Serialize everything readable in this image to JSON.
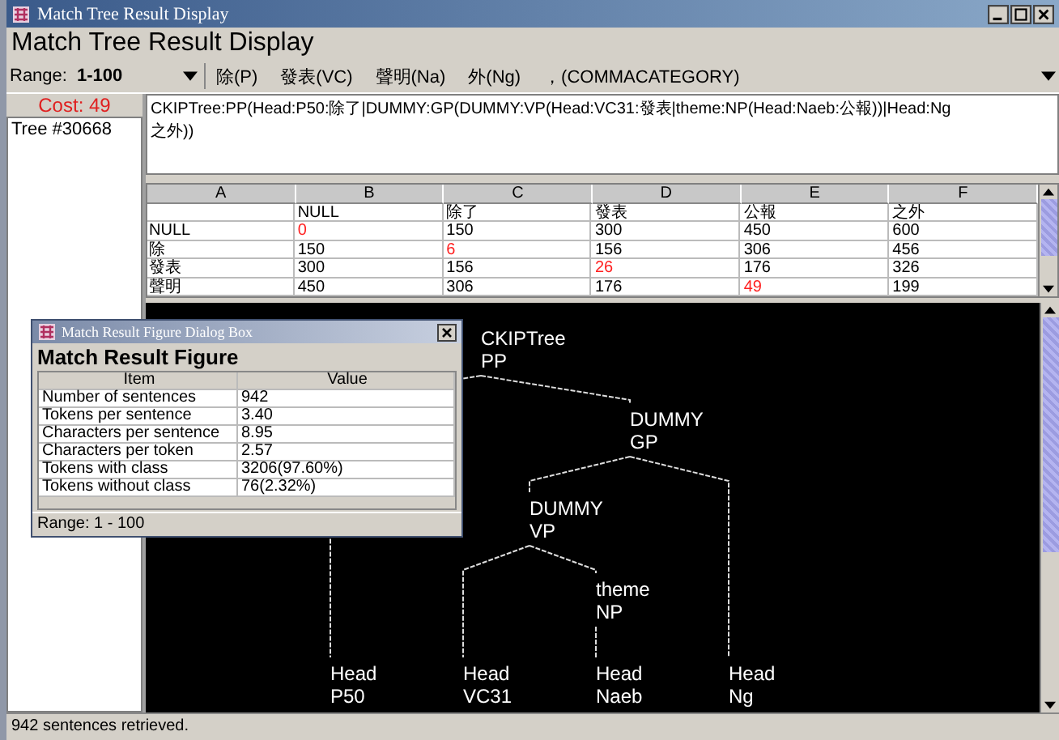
{
  "window": {
    "title": "Match Tree Result Display"
  },
  "heading": "Match Tree Result Display",
  "toolbar": {
    "range_label": "Range:",
    "range_value": "1-100",
    "tokens": [
      "除(P)",
      "發表(VC)",
      "聲明(Na)",
      "外(Ng)",
      "，(COMMACATEGORY)"
    ]
  },
  "sidebar": {
    "cost": "Cost: 49",
    "items": [
      {
        "label": "Tree #30668",
        "selected": false
      }
    ]
  },
  "bracket_text": [
    "CKIPTree:PP(Head:P50:除了|DUMMY:GP(DUMMY:VP(Head:VC31:發表|theme:NP(Head:Naeb:公報))|Head:Ng",
    "之外))"
  ],
  "table": {
    "columns": [
      "A",
      "B",
      "C",
      "D",
      "E",
      "F"
    ],
    "column_labels": [
      "NULL",
      "除了",
      "發表",
      "公報",
      "之外"
    ],
    "rows": [
      {
        "label": "NULL",
        "cells": [
          {
            "text": "0",
            "highlighted": true
          },
          {
            "text": "150",
            "highlighted": false
          },
          {
            "text": "300",
            "highlighted": false
          },
          {
            "text": "450",
            "highlighted": false
          },
          {
            "text": "600",
            "highlighted": false
          }
        ]
      },
      {
        "label": "除",
        "cells": [
          {
            "text": "150",
            "highlighted": false
          },
          {
            "text": "6",
            "highlighted": true
          },
          {
            "text": "156",
            "highlighted": false
          },
          {
            "text": "306",
            "highlighted": false
          },
          {
            "text": "456",
            "highlighted": false
          }
        ]
      },
      {
        "label": "發表",
        "cells": [
          {
            "text": "300",
            "highlighted": false
          },
          {
            "text": "156",
            "highlighted": false
          },
          {
            "text": "26",
            "highlighted": true
          },
          {
            "text": "176",
            "highlighted": false
          },
          {
            "text": "326",
            "highlighted": false
          }
        ]
      },
      {
        "label": "聲明",
        "cells": [
          {
            "text": "450",
            "highlighted": false
          },
          {
            "text": "306",
            "highlighted": false
          },
          {
            "text": "176",
            "highlighted": false
          },
          {
            "text": "49",
            "highlighted": true
          },
          {
            "text": "199",
            "highlighted": false
          }
        ]
      }
    ]
  },
  "tree": {
    "role": "CKIPTree",
    "category": "PP",
    "children": [
      {
        "role": "Head",
        "category": "P50"
      },
      {
        "role": "DUMMY",
        "category": "GP",
        "children": [
          {
            "role": "DUMMY",
            "category": "VP",
            "children": [
              {
                "role": "Head",
                "category": "VC31"
              },
              {
                "role": "theme",
                "category": "NP",
                "children": [
                  {
                    "role": "Head",
                    "category": "Naeb"
                  }
                ]
              }
            ]
          },
          {
            "role": "Head",
            "category": "Ng"
          }
        ]
      }
    ]
  },
  "dialog": {
    "title": "Match Result Figure Dialog Box",
    "heading": "Match Result Figure",
    "columns": [
      "Item",
      "Value"
    ],
    "rows": [
      {
        "item": "Number of sentences",
        "value": "942"
      },
      {
        "item": "Tokens per sentence",
        "value": "3.40"
      },
      {
        "item": "Characters per sentence",
        "value": "8.95"
      },
      {
        "item": "Characters per token",
        "value": "2.57"
      },
      {
        "item": "Tokens with class",
        "value": "3206(97.60%)"
      },
      {
        "item": "Tokens without class",
        "value": "76(2.32%)"
      }
    ],
    "status": "Range: 1 - 100"
  },
  "status_bar": "942 sentences retrieved."
}
